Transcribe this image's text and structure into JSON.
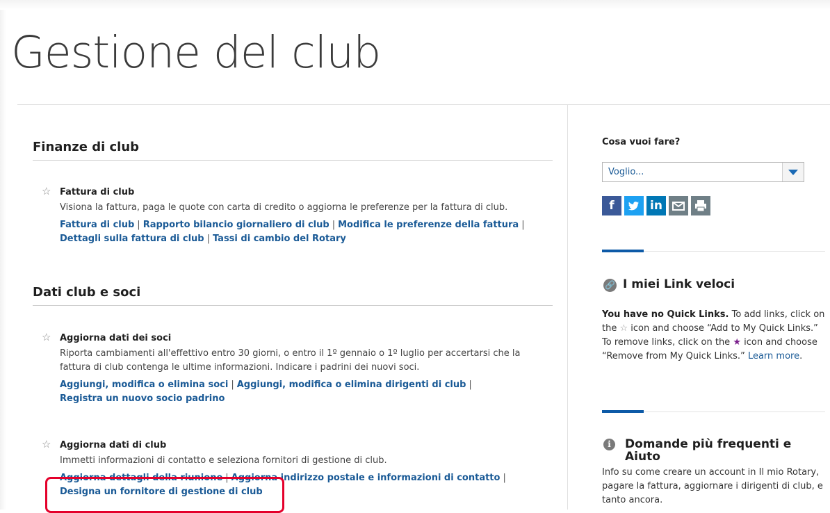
{
  "page": {
    "title": "Gestione del club"
  },
  "sections": [
    {
      "title": "Finanze di club",
      "items": [
        {
          "title": "Fattura di club",
          "description": "Visiona la fattura, paga le quote con carta di credito o aggiorna le preferenze per la fattura di club.",
          "links": [
            "Fattura di club",
            "Rapporto bilancio giornaliero di club",
            "Modifica le preferenze della fattura",
            "Dettagli sulla fattura di club",
            "Tassi di cambio del Rotary"
          ]
        }
      ]
    },
    {
      "title": "Dati club e soci",
      "items": [
        {
          "title": "Aggiorna dati dei soci",
          "description": "Riporta cambiamenti all'effettivo entro 30 giorni, o entro il 1º gennaio o 1º luglio per accertarsi che la fattura di club contenga le ultime informazioni. Indicare i padrini dei nuovi soci.",
          "links": [
            "Aggiungi, modifica o elimina soci",
            "Aggiungi, modifica o elimina dirigenti di club",
            "Registra un nuovo socio padrino"
          ]
        },
        {
          "title": "Aggiorna dati di club",
          "description": "Immetti informazioni di contatto e seleziona fornitori di gestione di club.",
          "links": [
            "Aggiorna dettagli della riunione",
            "Aggiorna indirizzo postale e informazioni di contatto",
            "Designa un fornitore di gestione di club"
          ]
        }
      ]
    }
  ],
  "sidebar": {
    "what_to_do": {
      "heading": "Cosa vuoi fare?",
      "select_value": "Voglio..."
    },
    "share_icons": [
      "facebook-icon",
      "twitter-icon",
      "linkedin-icon",
      "email-icon",
      "print-icon"
    ],
    "quick_links": {
      "title": "I miei Link veloci",
      "empty_bold": "You have no Quick Links.",
      "text_1": " To add links, click on the ",
      "text_2": " icon and choose “Add to My Quick Links.” To remove links, click on the ",
      "text_3": " icon and choose “Remove from My Quick Links.” ",
      "learn_more": "Learn more",
      "period": "."
    },
    "faq": {
      "title": "Domande più frequenti e Aiuto",
      "text": "Info su come creare un account in Il mio Rotary, pagare la fattura, aggiornare i dirigenti di club, e tanto ancora."
    }
  },
  "colors": {
    "link": "#1a5a96",
    "highlight": "#e4002b",
    "accent": "#0d5aa7"
  }
}
